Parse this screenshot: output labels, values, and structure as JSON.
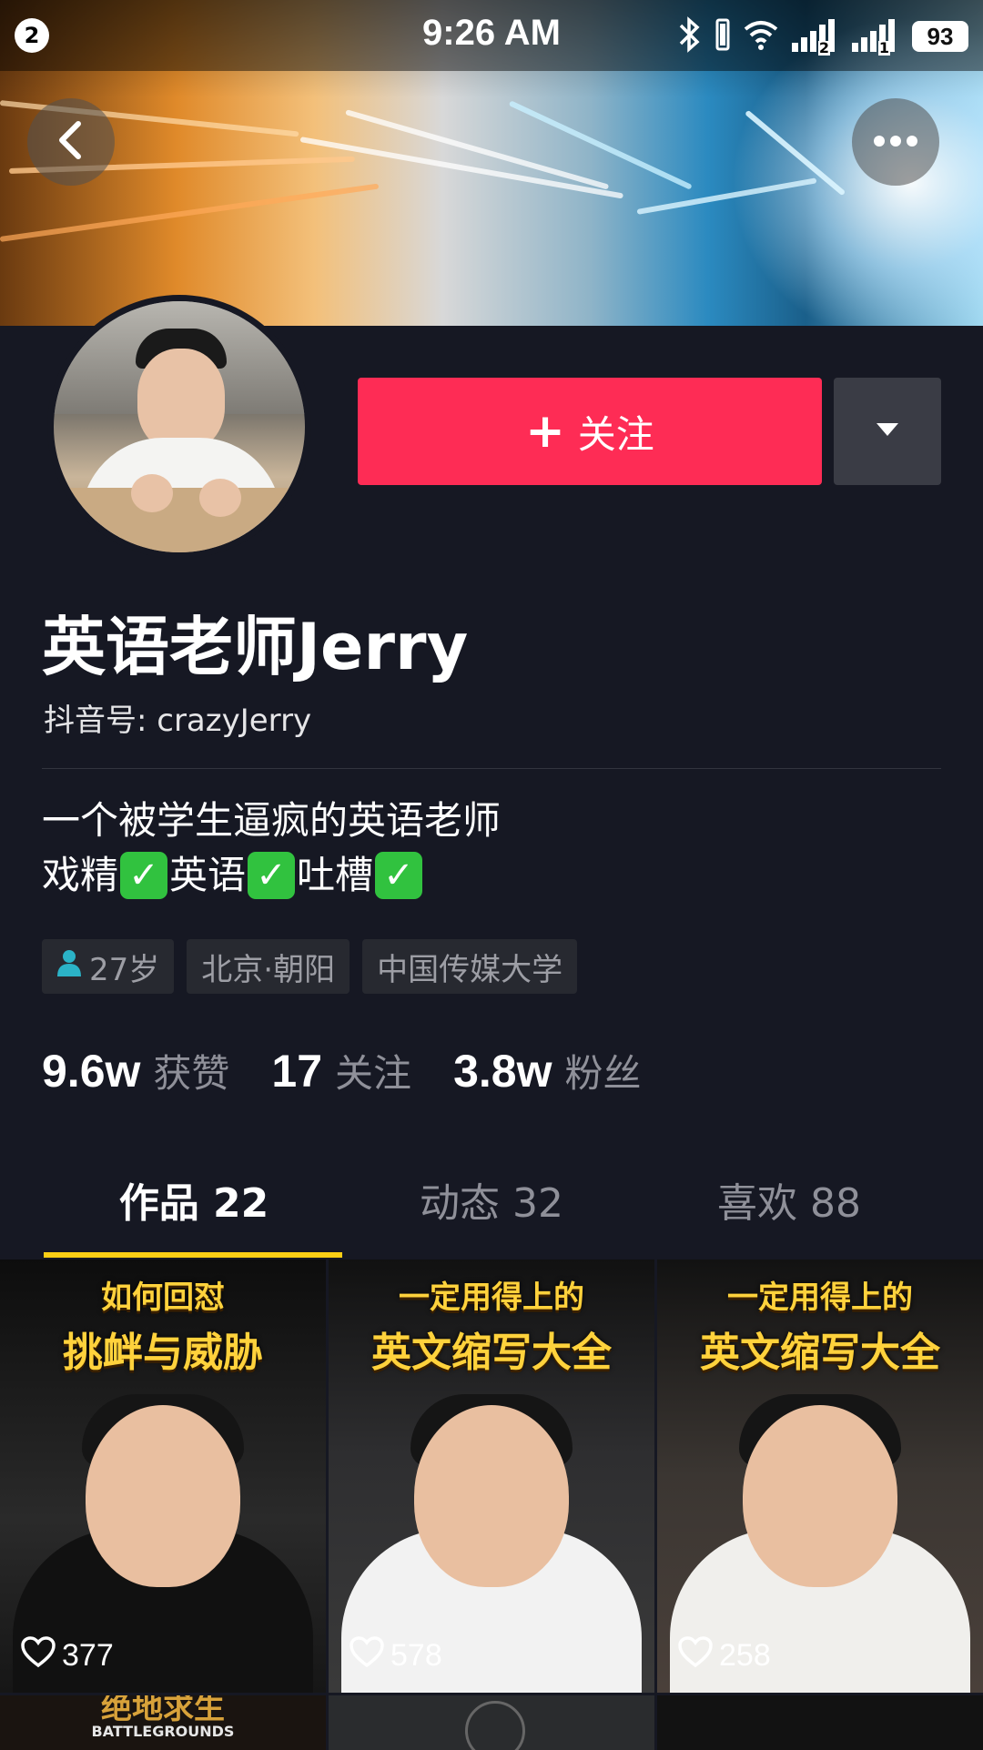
{
  "status_bar": {
    "notification_count": "2",
    "time": "9:26 AM",
    "battery": "93",
    "icons": [
      "bluetooth-icon",
      "wifi-icon",
      "signal-sim2-icon",
      "signal-sim1-icon"
    ],
    "sim2_label": "2",
    "sim1_label": "1"
  },
  "header": {
    "back_icon": "chevron-left-icon",
    "more_icon": "more-dots-icon"
  },
  "profile": {
    "follow_label": "关注",
    "follow_plus": "+",
    "name": "英语老师Jerry",
    "douyin_id": "抖音号: crazyJerry",
    "bio_line1": "一个被学生逼疯的英语老师",
    "bio_line2_parts": [
      "戏精",
      "英语",
      "吐槽"
    ],
    "check_glyph": "✓",
    "tags": [
      {
        "icon": "person-icon",
        "label": "27岁"
      },
      {
        "label": "北京·朝阳"
      },
      {
        "label": "中国传媒大学"
      }
    ],
    "stats": [
      {
        "value": "9.6w",
        "label": "获赞"
      },
      {
        "value": "17",
        "label": "关注"
      },
      {
        "value": "3.8w",
        "label": "粉丝"
      }
    ]
  },
  "tabs": [
    {
      "label": "作品 22",
      "active": true
    },
    {
      "label": "动态 32",
      "active": false
    },
    {
      "label": "喜欢 88",
      "active": false
    }
  ],
  "videos": [
    {
      "line1": "如何回怼",
      "line2": "挑衅与威胁",
      "likes": "377"
    },
    {
      "line1": "一定用得上的",
      "line2": "英文缩写大全",
      "likes": "578"
    },
    {
      "line1": "一定用得上的",
      "line2": "英文缩写大全",
      "likes": "258"
    }
  ],
  "next_row": {
    "caption": "绝地求生",
    "subcaption": "BATTLEGROUNDS"
  },
  "colors": {
    "background": "#161823",
    "follow_button": "#fe2c55",
    "tab_indicator": "#face15",
    "secondary_text": "#8f9099",
    "caption_yellow": "#ffd23c"
  }
}
